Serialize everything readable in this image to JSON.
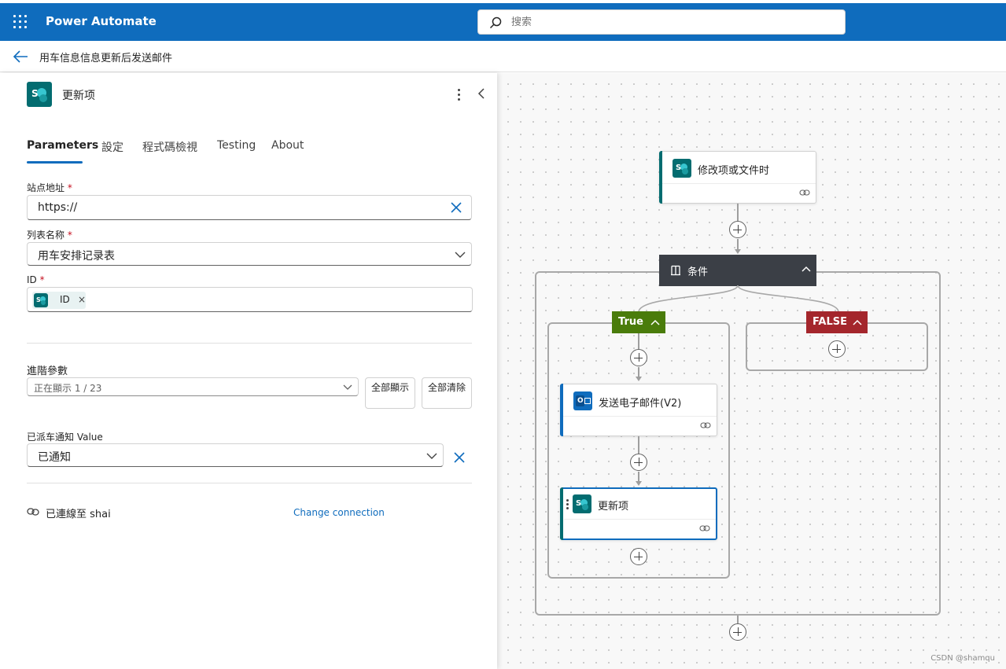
{
  "app": {
    "title": "Power Automate"
  },
  "search": {
    "placeholder": "搜索"
  },
  "breadcrumb": {
    "flow_name": "用车信息信息更新后发送邮件"
  },
  "panel": {
    "title": "更新项",
    "tabs": [
      {
        "label": "Parameters",
        "active": true
      },
      {
        "label": "設定"
      },
      {
        "label": "程式碼檢視"
      },
      {
        "label": "Testing"
      },
      {
        "label": "About"
      }
    ],
    "site_address": {
      "label": "站点地址",
      "required_mark": "*",
      "value": "https://"
    },
    "list_name": {
      "label": "列表名称",
      "required_mark": "*",
      "value": "用车安排记录表"
    },
    "id": {
      "label": "ID",
      "required_mark": "*",
      "token_label": "ID",
      "token_remove": "×"
    },
    "advanced": {
      "label": "進階參數",
      "selector_value": "正在顯示 1 / 23",
      "show_all": "全部顯示",
      "clear_all": "全部清除"
    },
    "dispatch": {
      "label": "已派车通知 Value",
      "value": "已通知"
    },
    "connection": {
      "label": "已連線至 shai",
      "change_link": "Change connection"
    }
  },
  "canvas": {
    "trigger": {
      "title": "修改项或文件时"
    },
    "condition": {
      "title": "条件"
    },
    "true_branch": {
      "label": "True"
    },
    "false_branch": {
      "label": "FALSE"
    },
    "send_email": {
      "title": "发送电子邮件(V2)"
    },
    "update_item": {
      "title": "更新项"
    },
    "watermark": "CSDN @shamqu"
  },
  "colors": {
    "brand": "#0f6cbd",
    "sharepoint": "#036c70",
    "true_green": "#4a7c0b",
    "false_red": "#a4262c",
    "condition_header": "#3b3f46",
    "outlook_blue": "#0f6cbd"
  },
  "icons": [
    "waffle-icon",
    "search-icon",
    "back-arrow-icon",
    "sharepoint-icon",
    "more-icon",
    "collapse-icon",
    "clear-icon",
    "chevron-down-icon",
    "link-icon",
    "add-icon",
    "condition-icon",
    "outlook-icon",
    "chevron-up-icon"
  ]
}
